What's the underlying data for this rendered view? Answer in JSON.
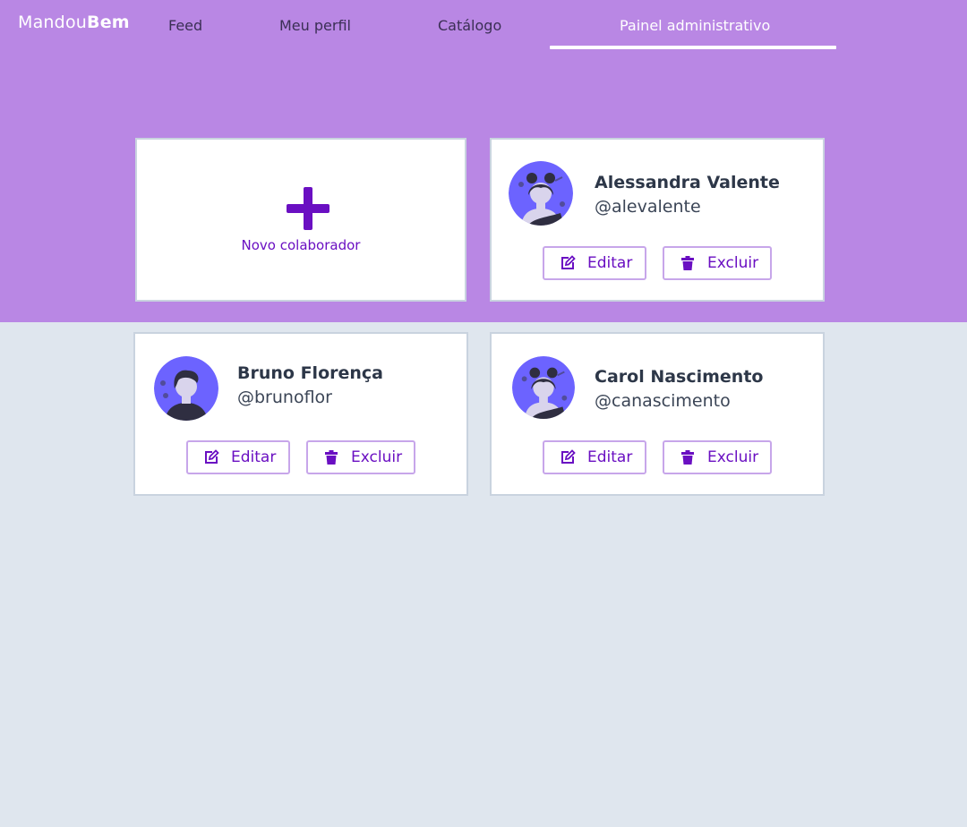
{
  "nav": {
    "brand_light": "Mandou",
    "brand_bold": "Bem",
    "items": [
      {
        "label": "Feed"
      },
      {
        "label": "Meu perfil"
      },
      {
        "label": "Catálogo"
      },
      {
        "label": "Painel administrativo",
        "active": true
      }
    ]
  },
  "new_collaborator": {
    "label": "Novo colaborador",
    "icon": "plus-icon"
  },
  "collaborators": [
    {
      "name": "Alessandra Valente",
      "handle": "@alevalente",
      "avatar": "female-avatar"
    },
    {
      "name": "Bruno Florença",
      "handle": "@brunoflor",
      "avatar": "male-avatar"
    },
    {
      "name": "Carol Nascimento",
      "handle": "@canascimento",
      "avatar": "female-avatar"
    }
  ],
  "actions": {
    "edit": "Editar",
    "delete": "Excluir",
    "edit_icon": "pencil-edit-icon",
    "delete_icon": "trash-icon"
  },
  "colors": {
    "hero": "#b987e4",
    "accent": "#6a0fc2",
    "page_bg": "#dfe6ee",
    "avatar_bg": "#6c63ff"
  }
}
